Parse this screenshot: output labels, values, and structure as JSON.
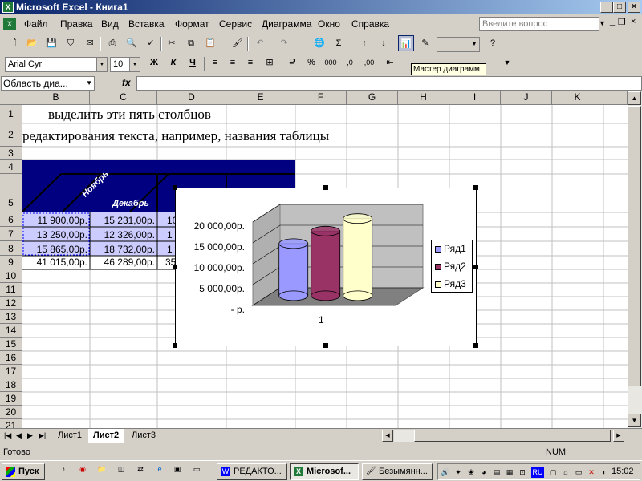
{
  "window": {
    "title": "Microsoft Excel - Книга1",
    "min": "_",
    "max": "□",
    "close": "×"
  },
  "menu": [
    "Файл",
    "Правка",
    "Вид",
    "Вставка",
    "Формат",
    "Сервис",
    "Диаграмма",
    "Окно",
    "Справка"
  ],
  "ask_placeholder": "Введите вопрос",
  "format_toolbar": {
    "font": "Arial Cyr",
    "size": "10",
    "bold": "Ж",
    "italic": "К",
    "underline": "Ч"
  },
  "tooltip": "Мастер диаграмм",
  "name_box": "Область диа...",
  "fx": "fx",
  "columns": [
    "B",
    "C",
    "D",
    "E",
    "F",
    "G",
    "H",
    "I",
    "J",
    "K"
  ],
  "rows": [
    "1",
    "2",
    "3",
    "4",
    "5",
    "6",
    "7",
    "8",
    "9",
    "10",
    "11",
    "12",
    "13",
    "14",
    "15",
    "16",
    "17",
    "18",
    "19",
    "20",
    "21"
  ],
  "cells": {
    "b1": "выделить эти пять столбцов",
    "a2": "редактирования текста, например, названия таблицы",
    "hdr_b": "Ноябрь",
    "hdr_c": "Декабрь",
    "r6": [
      "11 900,00р.",
      "15 231,00р.",
      "10"
    ],
    "r7": [
      "13 250,00р.",
      "12 326,00р.",
      "1"
    ],
    "r8": [
      "15 865,00р.",
      "18 732,00р.",
      "1"
    ],
    "r9": [
      "41 015,00р.",
      "46 289,00р.",
      "35"
    ]
  },
  "chart_data": {
    "type": "bar",
    "categories": [
      "1"
    ],
    "series": [
      {
        "name": "Ряд1",
        "values": [
          12500
        ],
        "color": "#9999ff"
      },
      {
        "name": "Ряд2",
        "values": [
          15500
        ],
        "color": "#993366"
      },
      {
        "name": "Ряд3",
        "values": [
          18500
        ],
        "color": "#ffffcc"
      }
    ],
    "y_ticks": [
      "20 000,00р.",
      "15 000,00р.",
      "10 000,00р.",
      "5 000,00р.",
      "-   р."
    ],
    "ylim": [
      0,
      20000
    ],
    "legend": "right",
    "grid": true
  },
  "sheet_tabs": [
    "Лист1",
    "Лист2",
    "Лист3"
  ],
  "active_tab": "Лист2",
  "status": {
    "left": "Готово",
    "num": "NUM"
  },
  "taskbar": {
    "start": "Пуск",
    "apps": [
      "РЕДАКТО...",
      "Microsof...",
      "Безымянн..."
    ],
    "lang": "RU",
    "clock": "15:02"
  }
}
